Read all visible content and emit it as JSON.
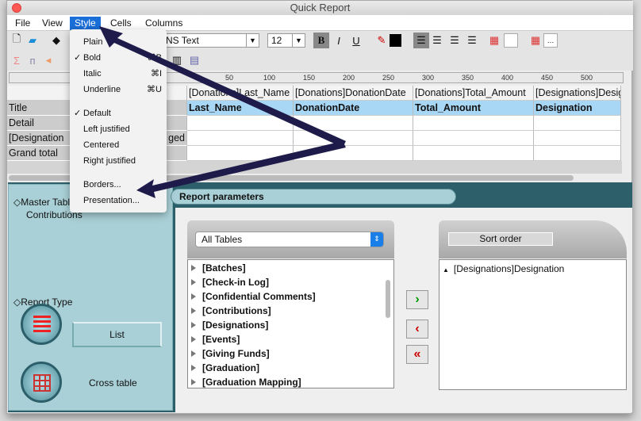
{
  "window": {
    "title": "Quick Report"
  },
  "menubar": [
    {
      "label": "File"
    },
    {
      "label": "View"
    },
    {
      "label": "Style"
    },
    {
      "label": "Cells"
    },
    {
      "label": "Columns"
    }
  ],
  "toolbar": {
    "font": "NS Text",
    "size": "12",
    "bold": "B",
    "italic": "I",
    "underline": "U"
  },
  "ruler": [
    "50",
    "100",
    "150",
    "200",
    "250",
    "300",
    "350",
    "400",
    "450",
    "500"
  ],
  "style_menu": [
    {
      "label": "Plain",
      "shortcut": "",
      "checked": false
    },
    {
      "label": "Bold",
      "shortcut": "⌘B",
      "checked": true
    },
    {
      "label": "Italic",
      "shortcut": "⌘I",
      "checked": false
    },
    {
      "label": "Underline",
      "shortcut": "⌘U",
      "checked": false
    },
    {
      "label": "Default",
      "shortcut": "",
      "checked": true
    },
    {
      "label": "Left justified",
      "shortcut": "",
      "checked": false
    },
    {
      "label": "Centered",
      "shortcut": "",
      "checked": false
    },
    {
      "label": "Right justified",
      "shortcut": "",
      "checked": false
    },
    {
      "label": "Borders...",
      "shortcut": "",
      "checked": false
    },
    {
      "label": "Presentation...",
      "shortcut": "",
      "checked": false
    }
  ],
  "grid": {
    "row_labels": [
      "Title",
      "Detail",
      "[Designation",
      "Grand total"
    ],
    "row_label_suffix": "ged",
    "columns": [
      {
        "header": "[Donations]Last_Name",
        "field": "Last_Name"
      },
      {
        "header": "[Donations]DonationDate",
        "field": "DonationDate"
      },
      {
        "header": "[Donations]Total_Amount",
        "field": "Total_Amount"
      },
      {
        "header": "[Designations]Designation",
        "field": "Designation"
      }
    ]
  },
  "panel": {
    "master_table_label": "Master Table",
    "master_table_value": "Contributions",
    "report_type_label": "Report Type",
    "list_label": "List",
    "cross_table_label": "Cross table",
    "tab_label": "Report parameters",
    "tables_select": "All Tables",
    "tables": [
      "[Batches]",
      "[Check-in Log]",
      "[Confidential Comments]",
      "[Contributions]",
      "[Designations]",
      "[Events]",
      "[Giving Funds]",
      "[Graduation]",
      "[Graduation Mapping]"
    ],
    "sort_order_label": "Sort order",
    "sort_items": [
      "[Designations]Designation"
    ]
  },
  "colors": {
    "accent": "#1a6ed8",
    "teal": "#a9d0d6",
    "field_row": "#a8d6f5",
    "arrow": "#1e1b4b"
  }
}
